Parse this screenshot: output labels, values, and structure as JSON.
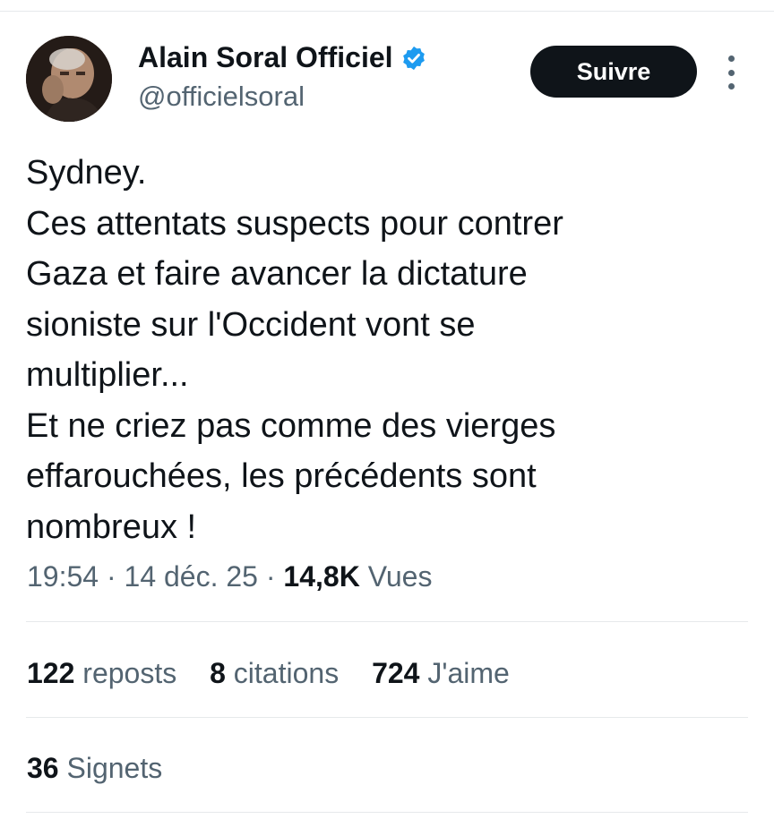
{
  "author": {
    "name": "Alain Soral Officiel",
    "handle": "@officielsoral",
    "verified_icon": "verified-badge-icon",
    "verified_color": "#1d9bf0"
  },
  "follow_button": {
    "label": "Suivre"
  },
  "more_menu": {
    "icon": "more-vertical-icon"
  },
  "tweet": {
    "lines": [
      "Sydney.",
      "Ces attentats suspects pour contrer",
      "Gaza et faire avancer la dictature",
      "sioniste sur l'Occident vont se",
      "multiplier...",
      "Et ne criez pas comme des vierges",
      "effarouchées, les précédents sont",
      "nombreux !"
    ]
  },
  "meta": {
    "time": "19:54",
    "separator": "·",
    "date": "14 déc. 25",
    "views_count": "14,8K",
    "views_label": "Vues"
  },
  "stats": {
    "reposts_count": "122",
    "reposts_label": "reposts",
    "quotes_count": "8",
    "quotes_label": "citations",
    "likes_count": "724",
    "likes_label": "J'aime",
    "bookmarks_count": "36",
    "bookmarks_label": "Signets"
  },
  "colors": {
    "text_primary": "#0f1419",
    "text_secondary": "#536471",
    "divider": "#e6e9eb",
    "button_bg": "#0f1419",
    "button_text": "#ffffff"
  }
}
